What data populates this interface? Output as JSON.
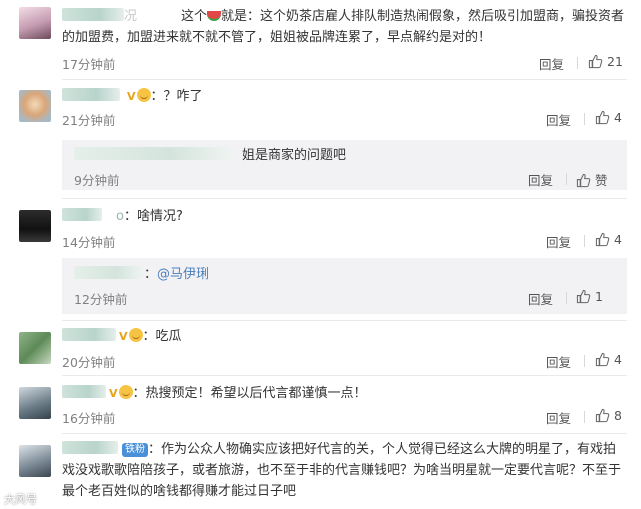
{
  "comments": [
    {
      "text_prefix": "这个",
      "text": "就是：这个奶茶店雇人排队制造热闹假象，然后吸引加盟商，骗投资者的加盟费，加盟进来就不就不管了，姐姐被品牌连累了，早点解约是对的！",
      "name_suffix": "况",
      "time": "17分钟前",
      "reply": "回复",
      "likes": "21"
    },
    {
      "text": "：？咋了",
      "time": "21分钟前",
      "reply": "回复",
      "likes": "4",
      "sub": {
        "text": "姐是商家的问题吧",
        "time": "9分钟前",
        "reply": "回复",
        "likes": "赞"
      }
    },
    {
      "name_suffix": "o",
      "text": "：啥情况?",
      "time": "14分钟前",
      "reply": "回复",
      "likes": "4",
      "sub": {
        "text_prefix": "：",
        "mention": "@马伊琍",
        "time": "12分钟前",
        "reply": "回复",
        "likes": "1"
      }
    },
    {
      "text": "：吃瓜",
      "time": "20分钟前",
      "reply": "回复",
      "likes": "4"
    },
    {
      "text": "：热搜预定！希望以后代言都谨慎一点！",
      "time": "16分钟前",
      "reply": "回复",
      "likes": "8"
    },
    {
      "fan_badge": "铁粉",
      "text": "：作为公众人物确实应该把好代言的关，个人觉得已经这么大牌的明星了，有戏拍戏没戏歌歌陪陪孩子，或者旅游，也不至于非的代言赚钱吧？为啥当明星就一定要代言呢？不至于最个老百姓似的啥钱都得赚才能过日子吧"
    }
  ],
  "badge_v": "V",
  "watermark": "大风号"
}
